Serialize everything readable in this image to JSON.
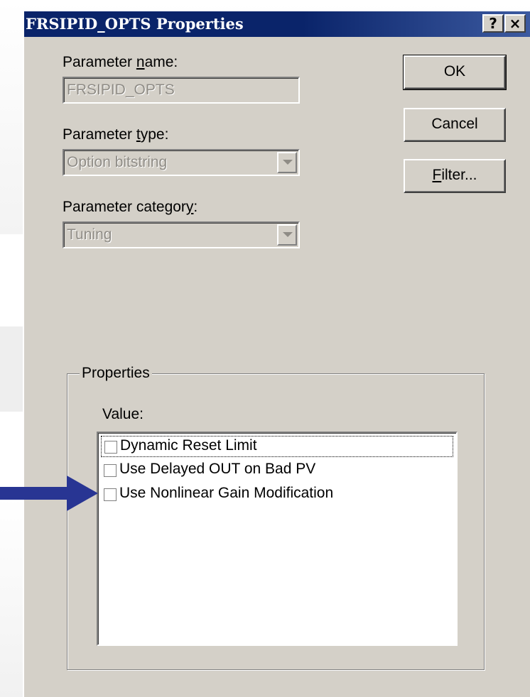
{
  "window": {
    "title": "FRSIPID_OPTS Properties",
    "help_button": "?",
    "close_button": "×"
  },
  "parameter_name": {
    "label_pre": "Parameter ",
    "label_accel": "n",
    "label_post": "ame:",
    "value": "FRSIPID_OPTS"
  },
  "parameter_type": {
    "label_pre": "Parameter ",
    "label_accel": "t",
    "label_post": "ype:",
    "value": "Option bitstring"
  },
  "parameter_category": {
    "label_pre": "Parameter categor",
    "label_accel": "y",
    "label_post": ":",
    "value": "Tuning"
  },
  "buttons": {
    "ok": "OK",
    "cancel": "Cancel",
    "filter_accel": "F",
    "filter_rest": "ilter..."
  },
  "properties": {
    "group_label": "Properties",
    "value_label": "Value:",
    "items": [
      {
        "label": "Dynamic Reset Limit",
        "checked": false,
        "focused": true
      },
      {
        "label": "Use Delayed OUT on Bad PV",
        "checked": false,
        "focused": false
      },
      {
        "label": "Use Nonlinear Gain Modification",
        "checked": false,
        "focused": false
      }
    ]
  },
  "colors": {
    "dialog_face": "#d4d0c8",
    "titlebar": "#0a246a",
    "annotation_arrow": "#283593"
  },
  "icons": [
    "help-icon",
    "close-icon",
    "dropdown-arrow-icon",
    "annotation-arrow-icon"
  ]
}
